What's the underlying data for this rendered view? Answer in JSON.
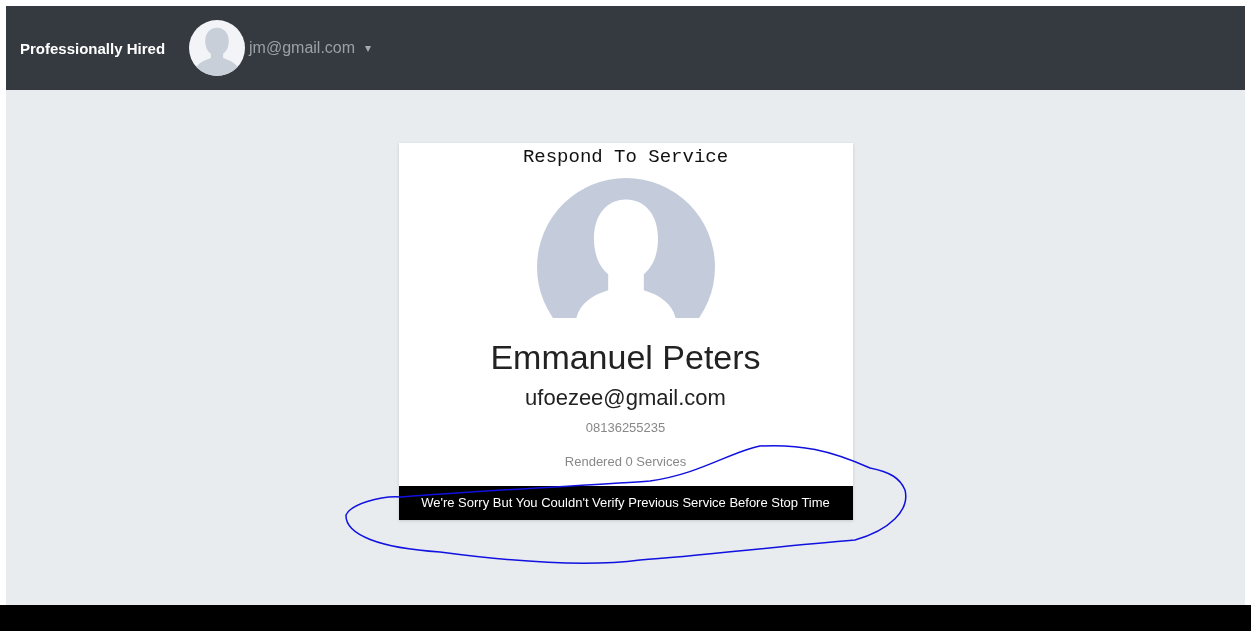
{
  "navbar": {
    "brand": "Professionally Hired",
    "user_email": "jm@gmail.com",
    "caret": "▾"
  },
  "card": {
    "title": "Respond To Service",
    "name": "Emmanuel Peters",
    "email": "ufoezee@gmail.com",
    "phone": "08136255235",
    "services": "Rendered 0 Services",
    "alert": "We're Sorry But You Couldn't Verify Previous Service Before Stop Time"
  }
}
